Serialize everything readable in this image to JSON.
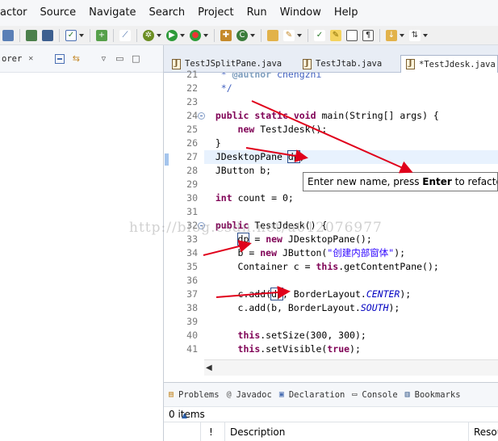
{
  "menubar": {
    "items": [
      "actor",
      "Source",
      "Navigate",
      "Search",
      "Project",
      "Run",
      "Window",
      "Help"
    ]
  },
  "left_panel": {
    "tab_label": "orer"
  },
  "editor": {
    "tabs": [
      {
        "label": "TestJSplitPane.java"
      },
      {
        "label": "TestJtab.java"
      },
      {
        "label": "*TestJdesk.java"
      }
    ],
    "lines": [
      {
        "num": "21",
        "text": "   * @author chengzhi"
      },
      {
        "num": "22",
        "text": "   */"
      },
      {
        "num": "23",
        "text": ""
      },
      {
        "num": "24",
        "text": "  public static void main(String[] args) {"
      },
      {
        "num": "25",
        "text": "      new TestJdesk();"
      },
      {
        "num": "26",
        "text": "  }"
      },
      {
        "num": "27",
        "text": "  JDesktopPane dp;"
      },
      {
        "num": "28",
        "text": "  JButton b;"
      },
      {
        "num": "29",
        "text": ""
      },
      {
        "num": "30",
        "text": "  int count = 0;"
      },
      {
        "num": "31",
        "text": ""
      },
      {
        "num": "32",
        "text": "  public TestJdesk() {"
      },
      {
        "num": "33",
        "text": "      dp = new JDesktopPane();"
      },
      {
        "num": "34",
        "text": "      b = new JButton(\"创建内部窗体\");"
      },
      {
        "num": "35",
        "text": "      Container c = this.getContentPane();"
      },
      {
        "num": "36",
        "text": ""
      },
      {
        "num": "37",
        "text": "      c.add(dp, BorderLayout.CENTER);"
      },
      {
        "num": "38",
        "text": "      c.add(b, BorderLayout.SOUTH);"
      },
      {
        "num": "39",
        "text": ""
      },
      {
        "num": "40",
        "text": "      this.setSize(300, 300);"
      },
      {
        "num": "41",
        "text": "      this.setVisible(true);"
      }
    ],
    "tooltip": {
      "before": "Enter new name, press ",
      "key": "Enter",
      "after": " to refactor"
    }
  },
  "watermark": "http://blog.csdn.net/u012076977",
  "bottom_panel": {
    "tabs": [
      "Problems",
      "Javadoc",
      "Declaration",
      "Console",
      "Bookmarks"
    ],
    "count": "0 items",
    "columns": [
      "!",
      "Description",
      "Resou"
    ]
  },
  "colors": {
    "keyword": "#7f0055",
    "comment": "#3f5fbf",
    "string": "#2a00ff",
    "field": "#0000c0",
    "arrow": "#e0001b",
    "current_line": "#e8f2fe"
  }
}
